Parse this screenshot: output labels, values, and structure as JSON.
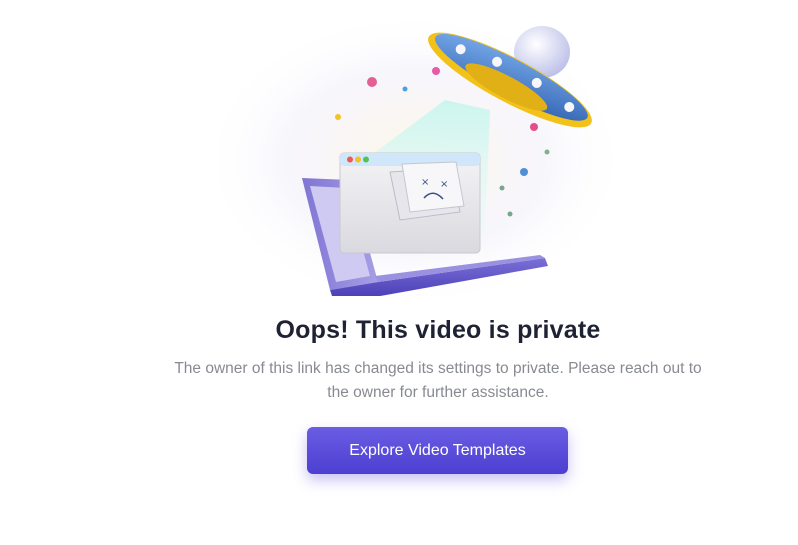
{
  "error": {
    "title": "Oops! This video is private",
    "message": "The owner of this link has changed its settings to private. Please reach out to the owner for further assistance."
  },
  "actions": {
    "explore_label": "Explore Video Templates"
  },
  "colors": {
    "accent": "#5b4ddb",
    "title": "#1f2233",
    "message": "#888a92",
    "laptop": "#6a5fc4",
    "ufo_body": "#4a86d4",
    "ufo_ring": "#f2c21a"
  },
  "icons": {
    "illustration": "ufo-abducting-laptop-illustration",
    "window_controls": "window-traffic-lights",
    "broken_file": "sad-face-file-icon"
  }
}
